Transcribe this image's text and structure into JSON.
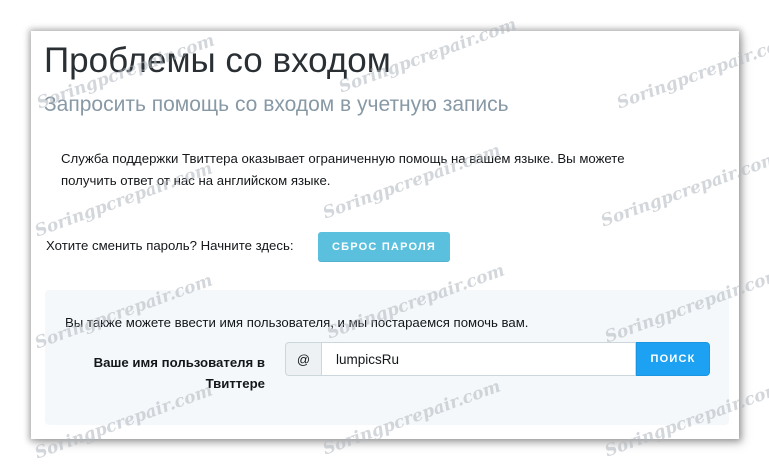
{
  "page": {
    "title": "Проблемы со входом",
    "subtitle": "Запросить помощь со входом в учетную запись",
    "support_text": "Служба поддержки Твиттера оказывает ограниченную помощь на вашем языке. Вы можете получить ответ от нас на английском языке.",
    "password_prompt": "Хотите сменить пароль? Начните здесь:",
    "reset_button": "СБРОС ПАРОЛЯ"
  },
  "username_panel": {
    "intro": "Вы также можете ввести имя пользователя, и мы постараемся помочь вам.",
    "label": "Ваше имя пользователя в Твиттере",
    "at_symbol": "@",
    "input_value": "lumpicsRu",
    "search_button": "ПОИСК"
  },
  "watermark": {
    "text": "Soringpcrepair.com"
  },
  "colors": {
    "reset_button": "#5bc0de",
    "search_button": "#1da1f2",
    "panel_bg": "#f5f8fa",
    "subtitle": "#8899a6"
  }
}
